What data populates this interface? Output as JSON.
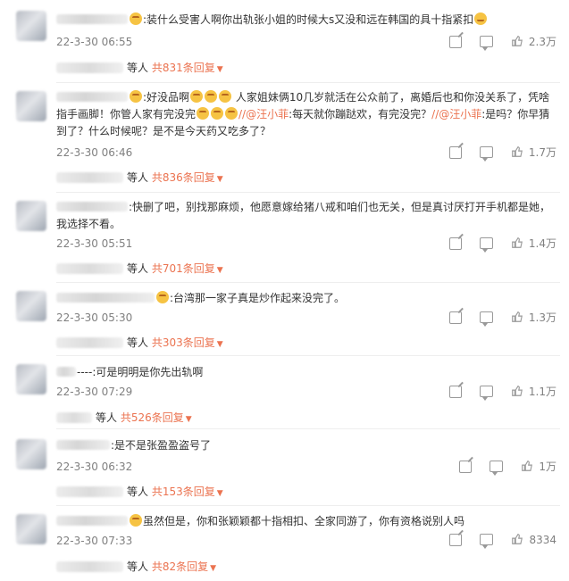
{
  "comments": [
    {
      "text_parts": [
        ":装什么受害人啊你出轨张小姐的时候大s又没和远在韩国的具十指紧扣"
      ],
      "time": "22-3-30 06:55",
      "likes": "2.3万",
      "reply_suffix": "等人",
      "reply_count": "共831条回复"
    },
    {
      "text_a": ":好没品啊",
      "text_b": " 人家姐妹俩10几岁就活在公众前了，离婚后也和你没关系了，凭啥指手画脚！你管人家有完没完",
      "mention1": "//@汪小菲",
      "text_c": ":每天就你蹦跶欢，有完没完？",
      "mention2": "//@汪小菲",
      "text_d": ":是吗？你早猜到了？什么时候呢？是不是今天药又吃多了？",
      "time": "22-3-30 06:46",
      "likes": "1.7万",
      "reply_suffix": "等人",
      "reply_count": "共836条回复"
    },
    {
      "text": ":快删了吧，别找那麻烦，他愿意嫁给猪八戒和咱们也无关，但是真讨厌打开手机都是她，我选择不看。",
      "time": "22-3-30 05:51",
      "likes": "1.4万",
      "reply_suffix": "等人",
      "reply_count": "共701条回复"
    },
    {
      "text": ":台湾那一家子真是炒作起来没完了。",
      "time": "22-3-30 05:30",
      "likes": "1.3万",
      "reply_suffix": "等人",
      "reply_count": "共303条回复"
    },
    {
      "text": "----:可是明明是你先出轨啊",
      "time": "22-3-30 07:29",
      "likes": "1.1万",
      "reply_suffix": "等人",
      "reply_count": "共526条回复"
    },
    {
      "text": ":是不是张盈盈盗号了",
      "time": "22-3-30 06:32",
      "likes": "1万",
      "reply_suffix": "等人",
      "reply_count": "共153条回复"
    },
    {
      "text": "虽然但是，你和张颖颖都十指相扣、全家同游了，你有资格说别人吗",
      "time": "22-3-30 07:33",
      "likes": "8334",
      "reply_suffix": "等人",
      "reply_count": "共82条回复"
    }
  ],
  "icons": {
    "share": "share-icon",
    "comment": "comment-icon",
    "like": "thumbs-up-icon",
    "dropdown": "caret-down-icon"
  },
  "colors": {
    "accent": "#eb7350",
    "meta": "#808080"
  }
}
